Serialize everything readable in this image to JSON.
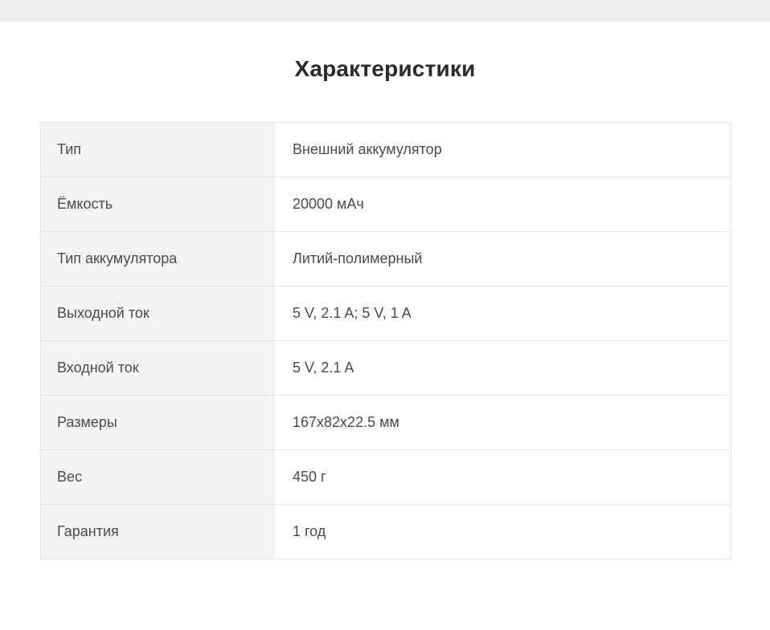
{
  "page": {
    "title": "Характеристики"
  },
  "specs": {
    "rows": [
      {
        "label": "Тип",
        "value": "Внешний аккумулятор"
      },
      {
        "label": "Ёмкость",
        "value": "20000 мАч"
      },
      {
        "label": "Тип аккумулятора",
        "value": "Литий-полимерный"
      },
      {
        "label": "Выходной ток",
        "value": "5 V, 2.1 A; 5 V, 1 A"
      },
      {
        "label": "Входной ток",
        "value": "5 V, 2.1 A"
      },
      {
        "label": "Размеры",
        "value": "167x82x22.5 мм"
      },
      {
        "label": "Вес",
        "value": "450 г"
      },
      {
        "label": "Гарантия",
        "value": "1 год"
      }
    ]
  },
  "colors": {
    "top_band": "#ececec",
    "label_cell_bg": "#f4f4f4",
    "border": "#e3e3e3",
    "title_text": "#2b2b2b",
    "body_text": "#4a4a4a"
  }
}
